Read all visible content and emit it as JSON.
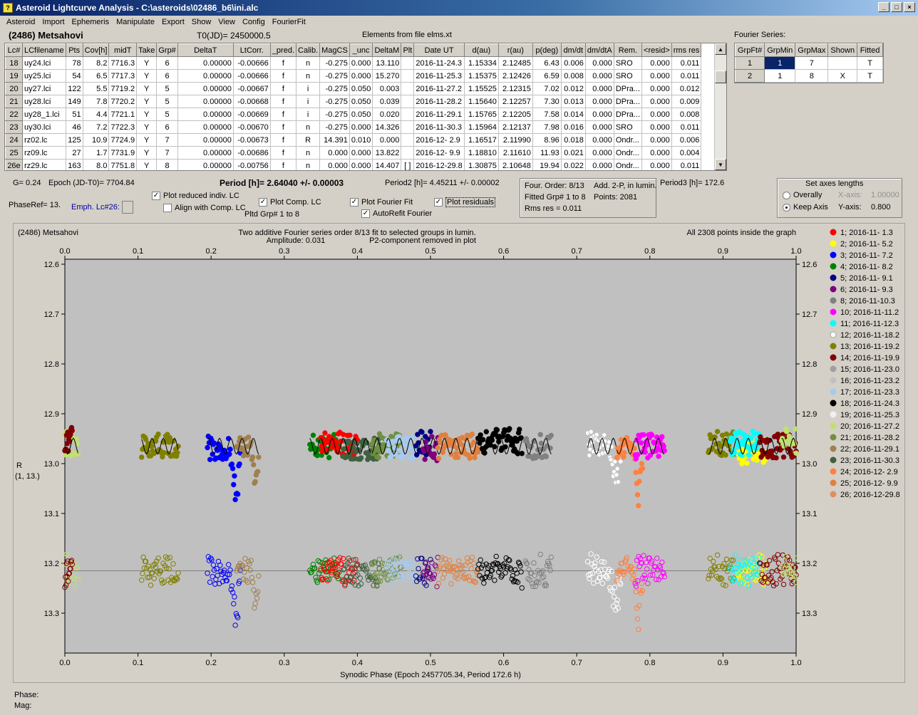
{
  "window": {
    "title": "Asteroid Lightcurve Analysis - C:\\asteroids\\02486_b6\\ini.alc",
    "buttons": [
      "_",
      "□",
      "×"
    ]
  },
  "menu": [
    "Asteroid",
    "Import",
    "Ephemeris",
    "Manipulate",
    "Export",
    "Show",
    "View",
    "Config",
    "FourierFit"
  ],
  "header": {
    "asteroid": "(2486) Metsahovi",
    "t0": "T0(JD)= 2450000.5",
    "elements": "Elements from file elms.xt",
    "fourier_title": "Fourier Series:"
  },
  "grid": {
    "columns": [
      "Lc#",
      "LCfilename",
      "Pts",
      "Cov[h]",
      "midT",
      "Take",
      "Grp#",
      "DeltaT",
      "LtCorr.",
      "_pred.",
      "Calib.",
      "MagCS",
      "_unc",
      "DeltaM",
      "Plt",
      "Date UT",
      "d(au)",
      "r(au)",
      "p(deg)",
      "dm/dt",
      "dm/dtA",
      "Rem.",
      "<resid>",
      "rms res"
    ],
    "rows": [
      [
        "18",
        "uy24.lci",
        "78",
        "8.2",
        "7716.3",
        "Y",
        "6",
        "0.00000",
        "-0.00666",
        "f",
        "n",
        "-0.275",
        "0.000",
        "13.110",
        "",
        "2016-11-24.3",
        "1.15334",
        "2.12485",
        "6.43",
        "0.006",
        "0.000",
        "SRO",
        "0.000",
        "0.011"
      ],
      [
        "19",
        "uy25.lci",
        "54",
        "6.5",
        "7717.3",
        "Y",
        "6",
        "0.00000",
        "-0.00666",
        "f",
        "n",
        "-0.275",
        "0.000",
        "15.270",
        "",
        "2016-11-25.3",
        "1.15375",
        "2.12426",
        "6.59",
        "0.008",
        "0.000",
        "SRO",
        "0.000",
        "0.011"
      ],
      [
        "20",
        "uy27.lci",
        "122",
        "5.5",
        "7719.2",
        "Y",
        "5",
        "0.00000",
        "-0.00667",
        "f",
        "i",
        "-0.275",
        "0.050",
        "0.003",
        "",
        "2016-11-27.2",
        "1.15525",
        "2.12315",
        "7.02",
        "0.012",
        "0.000",
        "DPra...",
        "0.000",
        "0.012"
      ],
      [
        "21",
        "uy28.lci",
        "149",
        "7.8",
        "7720.2",
        "Y",
        "5",
        "0.00000",
        "-0.00668",
        "f",
        "i",
        "-0.275",
        "0.050",
        "0.039",
        "",
        "2016-11-28.2",
        "1.15640",
        "2.12257",
        "7.30",
        "0.013",
        "0.000",
        "DPra...",
        "0.000",
        "0.009"
      ],
      [
        "22",
        "uy28_1.lci",
        "51",
        "4.4",
        "7721.1",
        "Y",
        "5",
        "0.00000",
        "-0.00669",
        "f",
        "i",
        "-0.275",
        "0.050",
        "0.020",
        "",
        "2016-11-29.1",
        "1.15765",
        "2.12205",
        "7.58",
        "0.014",
        "0.000",
        "DPra...",
        "0.000",
        "0.008"
      ],
      [
        "23",
        "uy30.lci",
        "46",
        "7.2",
        "7722.3",
        "Y",
        "6",
        "0.00000",
        "-0.00670",
        "f",
        "n",
        "-0.275",
        "0.000",
        "14.326",
        "",
        "2016-11-30.3",
        "1.15964",
        "2.12137",
        "7.98",
        "0.016",
        "0.000",
        "SRO",
        "0.000",
        "0.011"
      ],
      [
        "24",
        "rz02.lc",
        "125",
        "10.9",
        "7724.9",
        "Y",
        "7",
        "0.00000",
        "-0.00673",
        "f",
        "R",
        "14.391",
        "0.010",
        "0.000",
        "",
        "2016-12- 2.9",
        "1.16517",
        "2.11990",
        "8.96",
        "0.018",
        "0.000",
        "Ondr...",
        "0.000",
        "0.006"
      ],
      [
        "25",
        "rz09.lc",
        "27",
        "1.7",
        "7731.9",
        "Y",
        "7",
        "0.00000",
        "-0.00686",
        "f",
        "n",
        "0.000",
        "0.000",
        "13.822",
        "",
        "2016-12- 9.9",
        "1.18810",
        "2.11610",
        "11.93",
        "0.021",
        "0.000",
        "Ondr...",
        "0.000",
        "0.004"
      ],
      [
        "26e",
        "rz29.lc",
        "163",
        "8.0",
        "7751.8",
        "Y",
        "8",
        "0.00000",
        "-0.00756",
        "f",
        "n",
        "0.000",
        "0.000",
        "14.407",
        "[ ]",
        "2016-12-29.8",
        "1.30875",
        "2.10648",
        "19.94",
        "0.022",
        "0.000",
        "Ondr...",
        "0.000",
        "0.011"
      ]
    ]
  },
  "fourier_table": {
    "columns": [
      "GrpFt#",
      "GrpMin",
      "GrpMax",
      "Shown",
      "Fitted"
    ],
    "rows": [
      [
        "1",
        "1",
        "7",
        "",
        "T"
      ],
      [
        "2",
        "1",
        "8",
        "X",
        "T"
      ]
    ]
  },
  "info": {
    "g": "G= 0.24",
    "epoch": "Epoch (JD-T0)= 7704.84",
    "period": "Period [h]= 2.64040 +/- 0.00003",
    "period2": "Period2 [h]= 4.45211 +/- 0.00002",
    "period3": "Period3 [h]= 172.6",
    "phaseref": "PhaseRef= 13.",
    "emph": "Emph. Lc#26:",
    "pltd_grp": "Pltd Grp#  1   to   8",
    "four_order": "Four. Order:  8/13",
    "add2p": "Add. 2-P, in lumin.",
    "fitted_grp": "Fitted Grp# 1 to 8",
    "points": "Points: 2081",
    "rms": "Rms res     = 0.011"
  },
  "options": {
    "plot_reduced": "Plot reduced indiv. LC",
    "align_comp": "Align with Comp. LC",
    "plot_comp": "Plot Comp. LC",
    "plot_fourier": "Plot Fourier Fit",
    "autorefit": "AutoRefit Fourier",
    "plot_residuals": "Plot residuals"
  },
  "axes_box": {
    "title": "Set axes lengths",
    "overally": "Overally",
    "keep": "Keep Axis",
    "xaxis_label": "X-axis:",
    "xaxis_val": "1.00000",
    "yaxis_label": "Y-axis:",
    "yaxis_val": "0.800"
  },
  "chart_data": {
    "type": "scatter",
    "title_left": "(2486) Metsahovi",
    "title_center": "Two additive Fourier series order 8/13 fit to selected groups in lumin.",
    "subtitle_amp": "Amplitude: 0.031",
    "subtitle_p2": "P2-component removed in plot",
    "title_right": "All 2308 points inside the graph",
    "xlabel": "Synodic Phase (Epoch 2457705.34, Period 172.6 h)",
    "ylabel": "R",
    "ylabel2": "(1, 13.)",
    "xlim": [
      0.0,
      1.0
    ],
    "ylim": [
      13.38,
      12.59
    ],
    "x_ticks": [
      "0.0",
      "0.1",
      "0.2",
      "0.3",
      "0.4",
      "0.5",
      "0.6",
      "0.7",
      "0.8",
      "0.9",
      "1.0"
    ],
    "y_ticks": [
      "12.6",
      "12.7",
      "12.8",
      "12.9",
      "13.0",
      "13.1",
      "13.2",
      "13.3"
    ],
    "residual_baseline": 13.215,
    "legend": [
      {
        "label": "1; 2016-11- 1.3",
        "color": "#ff0000"
      },
      {
        "label": "2; 2016-11- 5.2",
        "color": "#ffff00"
      },
      {
        "label": "3; 2016-11- 7.2",
        "color": "#0000ff"
      },
      {
        "label": "4; 2016-11- 8.2",
        "color": "#008000"
      },
      {
        "label": "5; 2016-11- 9.1",
        "color": "#000080"
      },
      {
        "label": "6; 2016-11- 9.3",
        "color": "#800080"
      },
      {
        "label": "8; 2016-11-10.3",
        "color": "#808080"
      },
      {
        "label": "10; 2016-11-11.2",
        "color": "#ff00ff"
      },
      {
        "label": "11; 2016-11-12.3",
        "color": "#00ffff"
      },
      {
        "label": "12; 2016-11-18.2",
        "color": "#ffffff"
      },
      {
        "label": "13; 2016-11-19.2",
        "color": "#808000"
      },
      {
        "label": "14; 2016-11-19.9",
        "color": "#800000"
      },
      {
        "label": "15; 2016-11-23.0",
        "color": "#a0a0a0"
      },
      {
        "label": "16; 2016-11-23.2",
        "color": "#c0c0c0"
      },
      {
        "label": "17; 2016-11-23.3",
        "color": "#a6caf0"
      },
      {
        "label": "18; 2016-11-24.3",
        "color": "#000000"
      },
      {
        "label": "19; 2016-11-25.3",
        "color": "#f0f0f0"
      },
      {
        "label": "20; 2016-11-27.2",
        "color": "#c0e070"
      },
      {
        "label": "21; 2016-11-28.2",
        "color": "#709040"
      },
      {
        "label": "22; 2016-11-29.1",
        "color": "#a08050"
      },
      {
        "label": "23; 2016-11-30.3",
        "color": "#406040"
      },
      {
        "label": "24; 2016-12- 2.9",
        "color": "#ff8040"
      },
      {
        "label": "25; 2016-12- 9.9",
        "color": "#e08040"
      },
      {
        "label": "26; 2016-12-29.8",
        "color": "#e09060"
      }
    ],
    "segments": [
      {
        "color": "#c0e070",
        "x0": 0.0,
        "x1": 0.018,
        "mag": 12.96,
        "dip": 0
      },
      {
        "color": "#800000",
        "x0": 0.0,
        "x1": 0.01,
        "mag": 12.95,
        "dip": 0
      },
      {
        "color": "#808000",
        "x0": 0.105,
        "x1": 0.155,
        "mag": 12.965,
        "dip": 0
      },
      {
        "color": "#0000ff",
        "x0": 0.195,
        "x1": 0.24,
        "mag": 12.97,
        "dip": 0.11
      },
      {
        "color": "#a08050",
        "x0": 0.235,
        "x1": 0.265,
        "mag": 12.97,
        "dip": 0.07
      },
      {
        "color": "#008000",
        "x0": 0.335,
        "x1": 0.375,
        "mag": 12.965,
        "dip": 0
      },
      {
        "color": "#ff0000",
        "x0": 0.35,
        "x1": 0.4,
        "mag": 12.96,
        "dip": 0
      },
      {
        "color": "#406040",
        "x0": 0.38,
        "x1": 0.43,
        "mag": 12.97,
        "dip": 0
      },
      {
        "color": "#709040",
        "x0": 0.42,
        "x1": 0.46,
        "mag": 12.965,
        "dip": 0
      },
      {
        "color": "#a6caf0",
        "x0": 0.44,
        "x1": 0.48,
        "mag": 12.97,
        "dip": 0
      },
      {
        "color": "#000080",
        "x0": 0.48,
        "x1": 0.5,
        "mag": 12.96,
        "dip": 0
      },
      {
        "color": "#800080",
        "x0": 0.49,
        "x1": 0.51,
        "mag": 12.97,
        "dip": 0
      },
      {
        "color": "#e08040",
        "x0": 0.51,
        "x1": 0.565,
        "mag": 12.965,
        "dip": 0
      },
      {
        "color": "#000000",
        "x0": 0.565,
        "x1": 0.625,
        "mag": 12.955,
        "dip": 0
      },
      {
        "color": "#808080",
        "x0": 0.63,
        "x1": 0.665,
        "mag": 12.965,
        "dip": 0
      },
      {
        "color": "#ffffff",
        "x0": 0.715,
        "x1": 0.76,
        "mag": 12.96,
        "dip": 0.08
      },
      {
        "color": "#ff8040",
        "x0": 0.755,
        "x1": 0.79,
        "mag": 12.97,
        "dip": 0.11
      },
      {
        "color": "#ff00ff",
        "x0": 0.78,
        "x1": 0.82,
        "mag": 12.965,
        "dip": 0
      },
      {
        "color": "#808000",
        "x0": 0.88,
        "x1": 0.915,
        "mag": 12.96,
        "dip": 0
      },
      {
        "color": "#ffff00",
        "x0": 0.92,
        "x1": 0.96,
        "mag": 12.975,
        "dip": 0
      },
      {
        "color": "#00ffff",
        "x0": 0.91,
        "x1": 0.95,
        "mag": 12.96,
        "dip": 0
      },
      {
        "color": "#800000",
        "x0": 0.95,
        "x1": 1.0,
        "mag": 12.965,
        "dip": 0
      },
      {
        "color": "#c0e070",
        "x0": 0.98,
        "x1": 1.0,
        "mag": 12.955,
        "dip": 0
      }
    ]
  },
  "status": {
    "phase": "Phase:",
    "mag": "Mag:"
  }
}
